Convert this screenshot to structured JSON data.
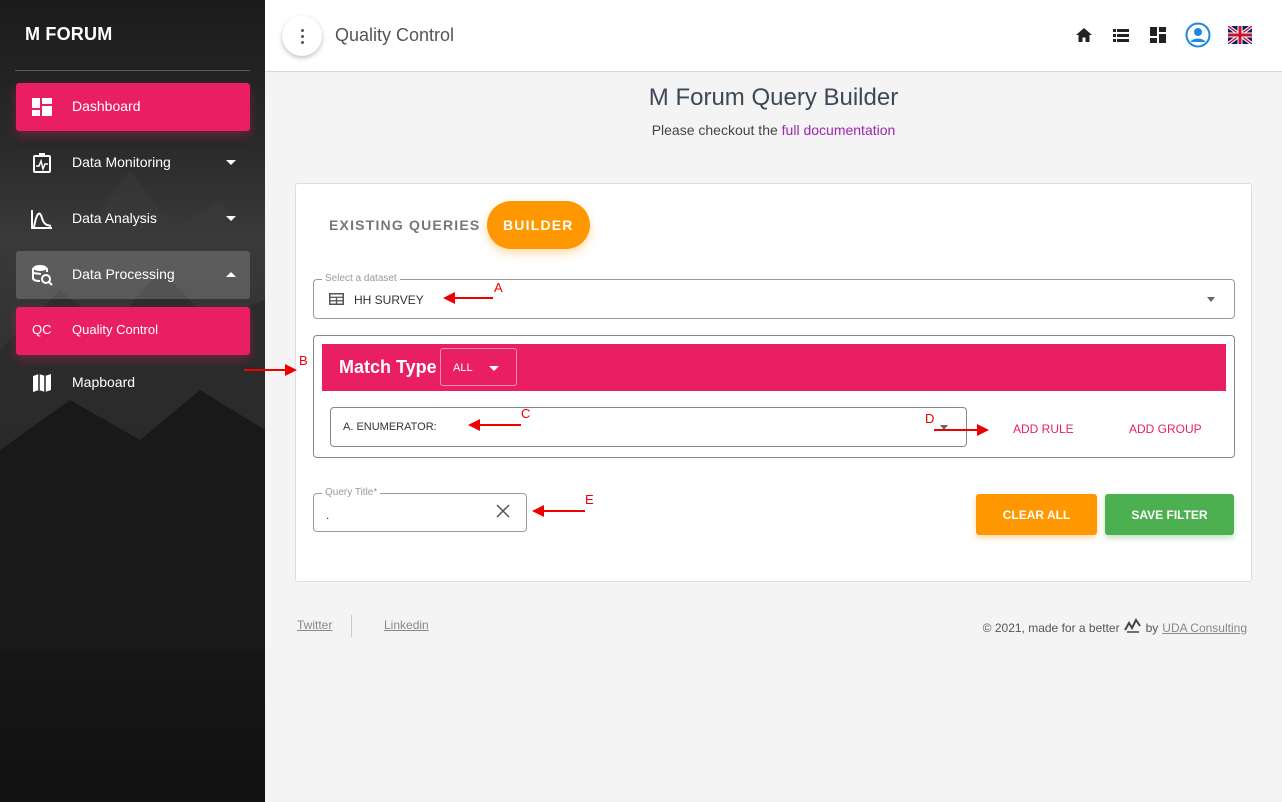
{
  "sidebar": {
    "brand": "M FORUM",
    "items": [
      {
        "label": "Dashboard"
      },
      {
        "label": "Data Monitoring"
      },
      {
        "label": "Data Analysis"
      },
      {
        "label": "Data Processing"
      },
      {
        "label": "Quality Control",
        "mini": "QC"
      },
      {
        "label": "Mapboard"
      }
    ]
  },
  "topbar": {
    "title": "Quality Control",
    "icons": [
      "home-icon",
      "list-icon",
      "dashboard-icon",
      "account-icon",
      "uk-flag-icon"
    ]
  },
  "main": {
    "title": "M Forum Query Builder",
    "subtitle_prefix": "Please checkout the ",
    "doc_link": "full documentation"
  },
  "builder": {
    "tabs": [
      "EXISTING QUERIES",
      "BUILDER"
    ],
    "dataset_legend": "Select a dataset",
    "dataset_value": "HH SURVEY",
    "match_type_label": "Match Type",
    "match_type_value": "ALL",
    "rule_value": "A. ENUMERATOR:",
    "add_rule": "ADD RULE",
    "add_group": "ADD GROUP",
    "query_title_legend": "Query Title*",
    "query_title_value": ".",
    "clear_all": "CLEAR ALL",
    "save_filter": "SAVE FILTER"
  },
  "annotations": [
    "A",
    "B",
    "C",
    "D",
    "E"
  ],
  "footer": {
    "twitter": "Twitter",
    "linkedin": "Linkedin",
    "copyright": "© 2021, made for a better",
    "by": "by",
    "company": "UDA Consulting"
  },
  "colors": {
    "primary_pink": "#e91e63",
    "orange": "#ff9800",
    "green": "#4caf50",
    "link_purple": "#9c27b0",
    "annotation_red": "#ee0000"
  }
}
